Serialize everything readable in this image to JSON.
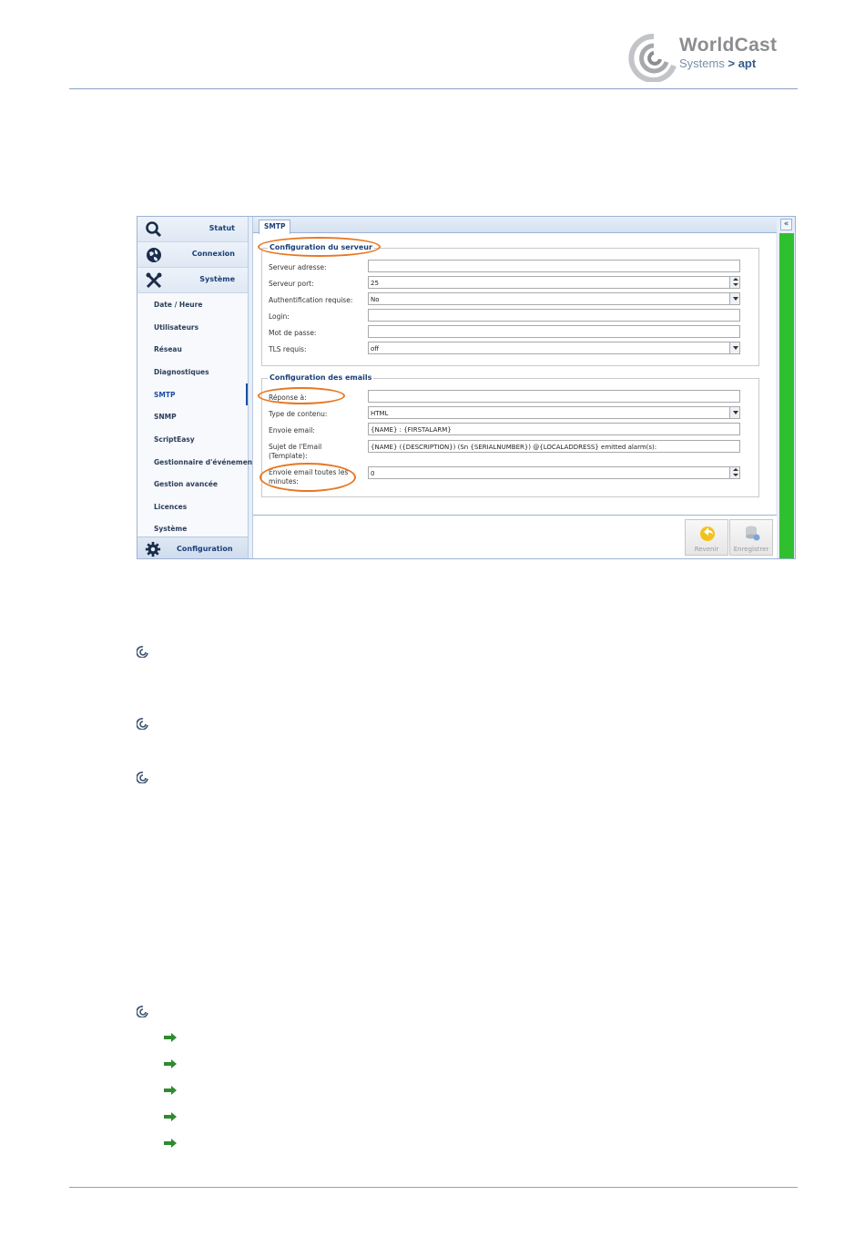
{
  "logo": {
    "brand": "WorldCast",
    "sub": "Systems",
    "chevron": ">",
    "sub_brand": "apt"
  },
  "app": {
    "sidebar": {
      "head_items": [
        {
          "label": "Statut",
          "icon": "search-icon"
        },
        {
          "label": "Connexion",
          "icon": "globe-icon"
        },
        {
          "label": "Système",
          "icon": "tools-icon"
        }
      ],
      "items": [
        "Date / Heure",
        "Utilisateurs",
        "Réseau",
        "Diagnostiques",
        "SMTP",
        "SNMP",
        "ScriptEasy",
        "Gestionnaire d'événemen",
        "Gestion avancée",
        "Licences",
        "Système"
      ],
      "active_item": "SMTP",
      "footer": {
        "label": "Configuration",
        "icon": "gear-icon"
      }
    },
    "tab": "SMTP",
    "collapse": "«",
    "server": {
      "legend": "Configuration du serveur",
      "address_label": "Serveur adresse:",
      "address_value": "",
      "port_label": "Serveur port:",
      "port_value": "25",
      "auth_label": "Authentification requise:",
      "auth_value": "No",
      "login_label": "Login:",
      "login_value": "",
      "password_label": "Mot de passe:",
      "password_value": "",
      "tls_label": "TLS requis:",
      "tls_value": "off"
    },
    "emails": {
      "legend": "Configuration des emails",
      "reply_label": "Réponse à:",
      "reply_value": "",
      "content_type_label": "Type de contenu:",
      "content_type_value": "HTML",
      "send_label": "Envoie email:",
      "send_value": "{NAME} : {FIRSTALARM}",
      "subject_label_1": "Sujet de l'Email",
      "subject_label_2": "(Template):",
      "subject_value": "{NAME} ({DESCRIPTION}) (Sn {SERIALNUMBER}) @{LOCALADDRESS} emitted alarm(s):",
      "interval_label_1": "Envoie email toutes les",
      "interval_label_2": "minutes:",
      "interval_value": "0"
    },
    "toolbar": {
      "revert_label": "Revenir",
      "save_label": "Enregistrer"
    }
  },
  "colors": {
    "accent": "#1a3f78",
    "highlight": "#e87722",
    "status_bar": "#2fbf2f"
  }
}
